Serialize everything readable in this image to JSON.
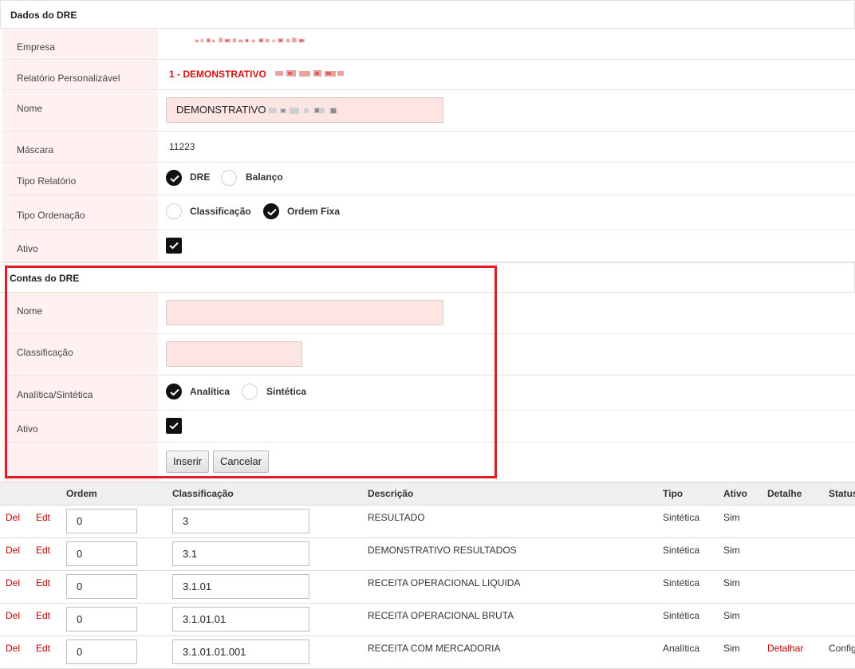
{
  "dados": {
    "title": "Dados do DRE",
    "empresa_label": "Empresa",
    "relatorio_label": "Relatório Personalizável",
    "relatorio_value": "1 - DEMONSTRATIVO",
    "nome_label": "Nome",
    "nome_value": "DEMONSTRATIVO",
    "mascara_label": "Máscara",
    "mascara_value": "11223",
    "tipo_relatorio_label": "Tipo Relatório",
    "tipo_relatorio_options": [
      "DRE",
      "Balanço"
    ],
    "tipo_relatorio_selected": "DRE",
    "tipo_ordenacao_label": "Tipo Ordenação",
    "tipo_ordenacao_options": [
      "Classificação",
      "Ordem Fixa"
    ],
    "tipo_ordenacao_selected": "Ordem Fixa",
    "ativo_label": "Ativo",
    "ativo_checked": true
  },
  "contas": {
    "title": "Contas do DRE",
    "nome_label": "Nome",
    "nome_value": "",
    "classificacao_label": "Classificação",
    "classificacao_value": "",
    "tipo_label": "Analítica/Sintética",
    "tipo_options": [
      "Analítica",
      "Sintética"
    ],
    "tipo_selected": "Analítica",
    "ativo_label": "Ativo",
    "ativo_checked": true,
    "inserir_label": "Inserir",
    "cancelar_label": "Cancelar"
  },
  "table": {
    "headers": [
      "Ordem",
      "Classificação",
      "Descrição",
      "Tipo",
      "Ativo",
      "Detalhe",
      "Status"
    ],
    "del_label": "Del",
    "edt_label": "Edt",
    "rows": [
      {
        "ordem": "0",
        "classificacao": "3",
        "descricao": "RESULTADO",
        "tipo": "Sintética",
        "ativo": "Sim",
        "detalhe": "",
        "status": ""
      },
      {
        "ordem": "0",
        "classificacao": "3.1",
        "descricao": "DEMONSTRATIVO RESULTADOS",
        "tipo": "Sintética",
        "ativo": "Sim",
        "detalhe": "",
        "status": ""
      },
      {
        "ordem": "0",
        "classificacao": "3.1.01",
        "descricao": "RECEITA OPERACIONAL LIQUIDA",
        "tipo": "Sintética",
        "ativo": "Sim",
        "detalhe": "",
        "status": ""
      },
      {
        "ordem": "0",
        "classificacao": "3.1.01.01",
        "descricao": "RECEITA OPERACIONAL BRUTA",
        "tipo": "Sintética",
        "ativo": "Sim",
        "detalhe": "",
        "status": ""
      },
      {
        "ordem": "0",
        "classificacao": "3.1.01.01.001",
        "descricao": "RECEITA COM MERCADORIA",
        "tipo": "Analítica",
        "ativo": "Sim",
        "detalhe": "Detalhar",
        "status": "Config"
      }
    ]
  },
  "colors": {
    "label_bg": "#fff1f0",
    "input_bg": "#fce5e3",
    "link_red": "#c00000",
    "highlight_red": "#e21b24"
  }
}
